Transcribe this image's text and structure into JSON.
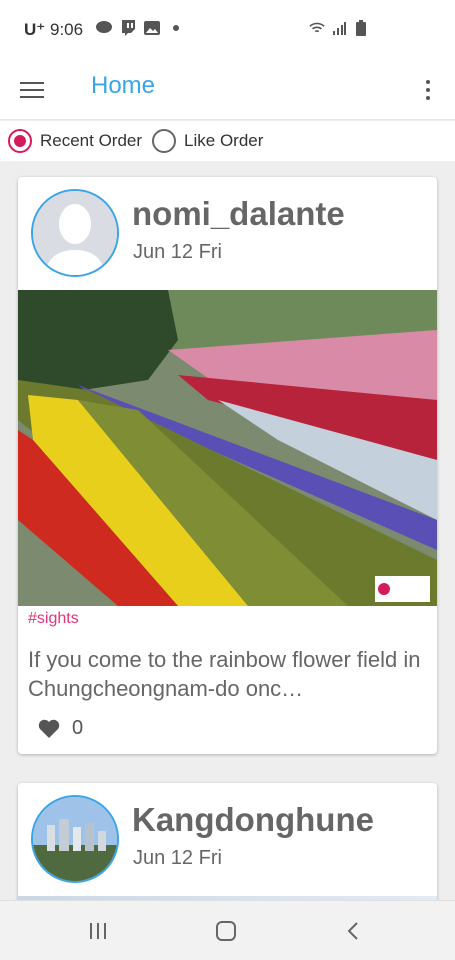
{
  "status_bar": {
    "carrier": "U⁺",
    "time": "9:06"
  },
  "app_bar": {
    "title": "Home"
  },
  "filter": {
    "options": [
      {
        "label": "Recent Order",
        "selected": true
      },
      {
        "label": "Like Order",
        "selected": false
      }
    ]
  },
  "posts": [
    {
      "username": "nomi_dalante",
      "date": "Jun 12 Fri",
      "tag": "#sights",
      "text": "If you come to the rainbow flower field in Chungcheongnam-do onc…",
      "likes": "0"
    },
    {
      "username": "Kangdonghune",
      "date": "Jun 12 Fri"
    }
  ],
  "colors": {
    "accent": "#3aa5e6",
    "radio": "#d51b5e",
    "tag": "#e0357a"
  }
}
